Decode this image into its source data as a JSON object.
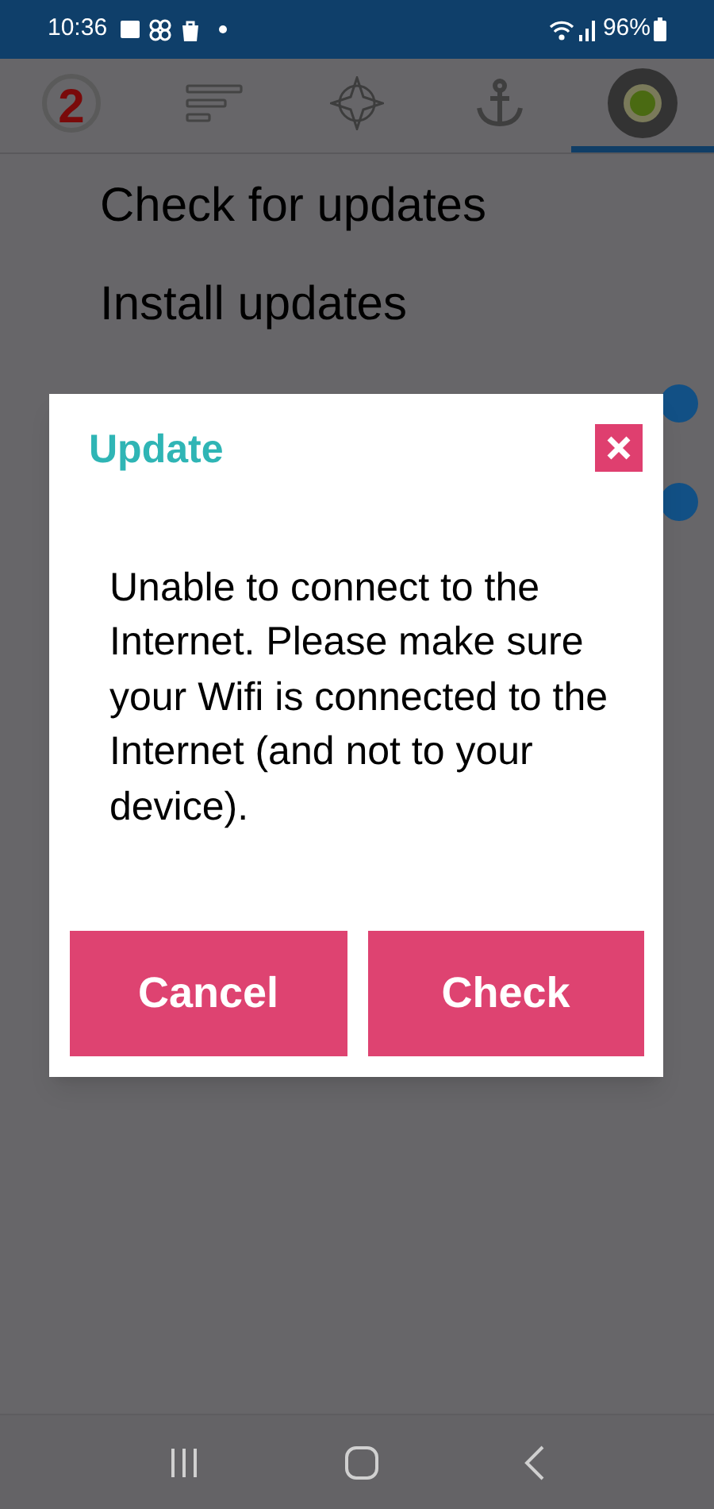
{
  "status_bar": {
    "time": "10:36",
    "battery": "96%"
  },
  "tabs": [
    {
      "badge": "2",
      "selected": false
    },
    {
      "selected": false
    },
    {
      "selected": false
    },
    {
      "selected": false
    },
    {
      "selected": true
    }
  ],
  "menu": [
    {
      "label": "Check for updates"
    },
    {
      "label": "Install updates"
    }
  ],
  "toggles": [
    {
      "on": true
    },
    {
      "on": true
    }
  ],
  "dialog": {
    "title": "Update",
    "message": "Unable to connect to the Internet. Please make sure your Wifi is connected to the Internet (and not to your device).",
    "buttons": [
      "Cancel",
      "Check"
    ]
  }
}
